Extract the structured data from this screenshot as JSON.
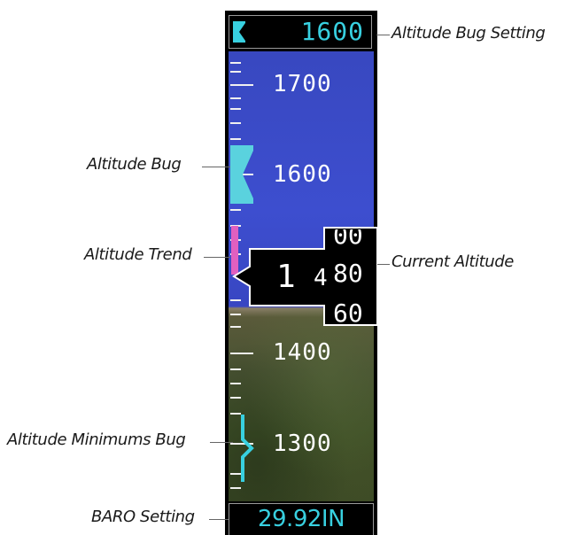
{
  "annotations": {
    "altitude_bug_setting": "Altitude Bug Setting",
    "altitude_bug": "Altitude Bug",
    "altitude_trend": "Altitude Trend",
    "current_altitude": "Current Altitude",
    "altitude_minimums_bug": "Altitude Minimums Bug",
    "baro_setting": "BARO Setting"
  },
  "altimeter": {
    "bug_setting": "1600",
    "tape_labels": [
      "1700",
      "1600",
      "1400",
      "1300"
    ],
    "current_altitude": {
      "leading_digit": "1",
      "hundreds_digit": "4",
      "roller_above": "00",
      "roller_current": "80",
      "roller_below": "60"
    },
    "baro_setting": "29.92IN"
  },
  "colors": {
    "sky": "#3d4ecf",
    "ground": "#3f5228",
    "bug_cyan": "#38d0e0",
    "trend_magenta": "#e060c0",
    "text_white": "#ffffff"
  }
}
